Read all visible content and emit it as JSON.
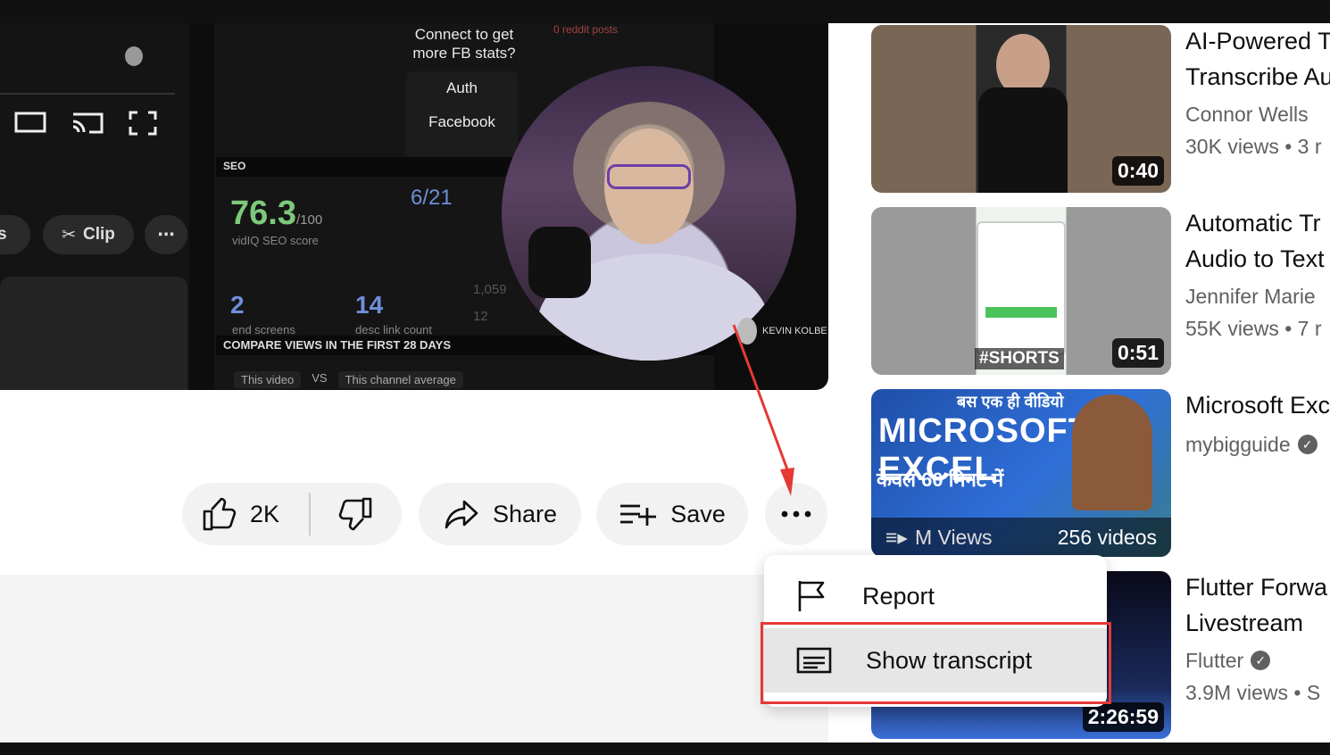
{
  "player": {
    "connect_text": "Connect to get more FB stats?",
    "reddit_text": "0 reddit posts",
    "auth_label": "Auth",
    "facebook_label": "Facebook",
    "seo_header": "SEO",
    "seo_score": "76.3",
    "seo_score_max": "/100",
    "seo_score_label": "vidIQ SEO score",
    "ratio_label": "6/21",
    "end_screens_value": "2",
    "end_screens_label": "end screens",
    "desc_link_value": "14",
    "desc_link_label": "desc link count",
    "views_small": "1,059",
    "small_12": "12",
    "compare_header": "COMPARE VIEWS IN THE FIRST 28 DAYS",
    "compare_this": "This video",
    "compare_vs": "VS",
    "compare_avg": "This channel average",
    "clip_label": "Clip",
    "left_pill_label": "ks",
    "watermark_text": "KEVIN KOLBE"
  },
  "actions": {
    "like_count": "2K",
    "share_label": "Share",
    "save_label": "Save"
  },
  "menu": {
    "report_label": "Report",
    "transcript_label": "Show transcript"
  },
  "sidebar": [
    {
      "title1": "AI-Powered T",
      "title2": "Transcribe Au",
      "channel": "Connor Wells",
      "meta": "30K views  • 3 r",
      "duration": "0:40"
    },
    {
      "title1": "Automatic Tr",
      "title2": "Audio to Text",
      "channel": "Jennifer Marie",
      "meta": "55K views  • 7 r",
      "duration": "0:51",
      "tag": "#SHORTS"
    },
    {
      "title1": "Microsoft Exc",
      "channel": "mybigguide",
      "playlist_count": "256 videos",
      "playlist_left": "M Views",
      "thumb_title": "MICROSOFT EXCEL",
      "thumb_hindi": "बस एक ही वीडियो",
      "thumb_sub": "केवल 60 मिनट में"
    },
    {
      "title1": "Flutter Forwa",
      "title2": "Livestream",
      "channel": "Flutter",
      "meta": "3.9M views  • S",
      "duration": "2:26:59"
    }
  ]
}
